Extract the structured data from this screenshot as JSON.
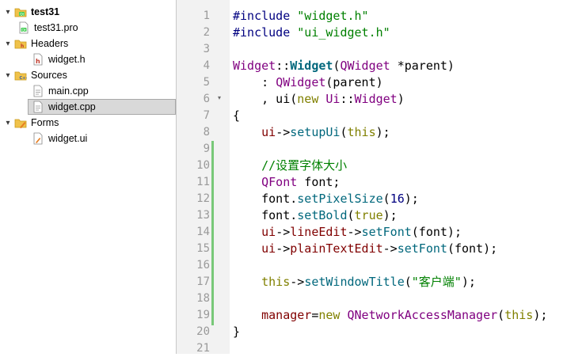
{
  "project_tree": {
    "items": [
      {
        "label": "test31",
        "icon": "qt-project-icon",
        "expander": "▾",
        "bold": true
      },
      {
        "label": "test31.pro",
        "icon": "qt-pro-file-icon",
        "expander": ""
      },
      {
        "label": "Headers",
        "icon": "headers-folder-icon",
        "expander": "▾"
      },
      {
        "label": "widget.h",
        "icon": "header-file-icon",
        "expander": ""
      },
      {
        "label": "Sources",
        "icon": "sources-folder-icon",
        "expander": "▾"
      },
      {
        "label": "main.cpp",
        "icon": "cpp-file-icon",
        "expander": ""
      },
      {
        "label": "widget.cpp",
        "icon": "cpp-file-icon",
        "expander": "",
        "selected": true
      },
      {
        "label": "Forms",
        "icon": "forms-folder-icon",
        "expander": "▾"
      },
      {
        "label": "widget.ui",
        "icon": "ui-file-icon",
        "expander": ""
      }
    ]
  },
  "editor": {
    "line_numbers": [
      "1",
      "2",
      "3",
      "4",
      "5",
      "6",
      "7",
      "8",
      "9",
      "10",
      "11",
      "12",
      "13",
      "14",
      "15",
      "16",
      "17",
      "18",
      "19",
      "20",
      "21"
    ],
    "fold_marker": "▾",
    "lines": [
      [
        [
          "pre",
          "#include "
        ],
        [
          "str",
          "\"widget.h\""
        ]
      ],
      [
        [
          "pre",
          "#include "
        ],
        [
          "str",
          "\"ui_widget.h\""
        ]
      ],
      [],
      [
        [
          "type",
          "Widget"
        ],
        [
          "op",
          "::"
        ],
        [
          "func",
          "Widget"
        ],
        [
          "op",
          "("
        ],
        [
          "type",
          "QWidget"
        ],
        [
          "op",
          " *parent)"
        ]
      ],
      [
        [
          "op",
          "    : "
        ],
        [
          "type",
          "QWidget"
        ],
        [
          "op",
          "(parent)"
        ]
      ],
      [
        [
          "op",
          "    , ui("
        ],
        [
          "kw",
          "new"
        ],
        [
          "op",
          " "
        ],
        [
          "type",
          "Ui"
        ],
        [
          "op",
          "::"
        ],
        [
          "type",
          "Widget"
        ],
        [
          "op",
          ")"
        ]
      ],
      [
        [
          "op",
          "{"
        ]
      ],
      [
        [
          "op",
          "    "
        ],
        [
          "mem",
          "ui"
        ],
        [
          "op",
          "->"
        ],
        [
          "meth",
          "setupUi"
        ],
        [
          "op",
          "("
        ],
        [
          "kw",
          "this"
        ],
        [
          "op",
          ");"
        ]
      ],
      [],
      [
        [
          "op",
          "    "
        ],
        [
          "cmt",
          "//设置字体大小"
        ]
      ],
      [
        [
          "op",
          "    "
        ],
        [
          "type",
          "QFont"
        ],
        [
          "op",
          " font;"
        ]
      ],
      [
        [
          "op",
          "    font."
        ],
        [
          "meth",
          "setPixelSize"
        ],
        [
          "op",
          "("
        ],
        [
          "num",
          "16"
        ],
        [
          "op",
          ");"
        ]
      ],
      [
        [
          "op",
          "    font."
        ],
        [
          "meth",
          "setBold"
        ],
        [
          "op",
          "("
        ],
        [
          "kw",
          "true"
        ],
        [
          "op",
          ");"
        ]
      ],
      [
        [
          "op",
          "    "
        ],
        [
          "mem",
          "ui"
        ],
        [
          "op",
          "->"
        ],
        [
          "mem",
          "lineEdit"
        ],
        [
          "op",
          "->"
        ],
        [
          "meth",
          "setFont"
        ],
        [
          "op",
          "(font);"
        ]
      ],
      [
        [
          "op",
          "    "
        ],
        [
          "mem",
          "ui"
        ],
        [
          "op",
          "->"
        ],
        [
          "mem",
          "plainTextEdit"
        ],
        [
          "op",
          "->"
        ],
        [
          "meth",
          "setFont"
        ],
        [
          "op",
          "(font);"
        ]
      ],
      [],
      [
        [
          "op",
          "    "
        ],
        [
          "kw",
          "this"
        ],
        [
          "op",
          "->"
        ],
        [
          "meth",
          "setWindowTitle"
        ],
        [
          "op",
          "("
        ],
        [
          "str",
          "\"客户端\""
        ],
        [
          "op",
          ");"
        ]
      ],
      [],
      [
        [
          "op",
          "    "
        ],
        [
          "mem",
          "manager"
        ],
        [
          "op",
          "="
        ],
        [
          "kw",
          "new"
        ],
        [
          "op",
          " "
        ],
        [
          "type",
          "QNetworkAccessManager"
        ],
        [
          "op",
          "("
        ],
        [
          "kw",
          "this"
        ],
        [
          "op",
          ");"
        ]
      ],
      [
        [
          "op",
          "}"
        ]
      ],
      []
    ],
    "colors": {
      "preprocessor": "#000080",
      "string": "#008000",
      "type": "#800080",
      "function": "#00677c",
      "keyword": "#808000",
      "member": "#800000",
      "number": "#000080",
      "comment": "#008000",
      "change_bar": "#78c878"
    }
  }
}
